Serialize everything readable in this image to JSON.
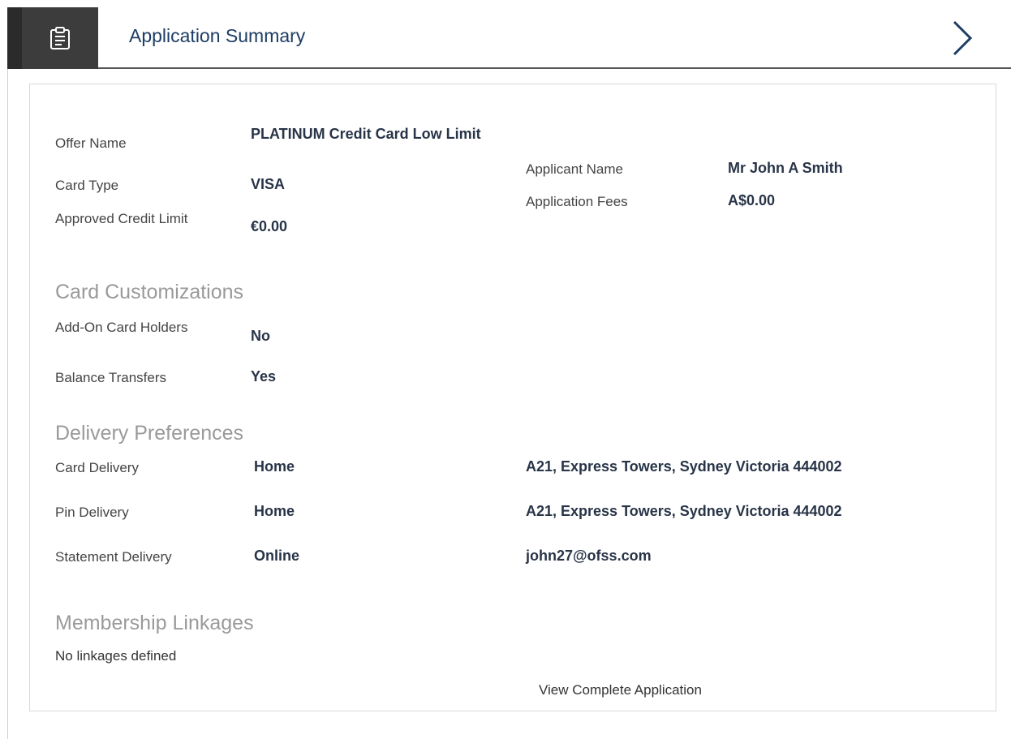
{
  "header": {
    "title": "Application Summary",
    "icon": "clipboard-icon",
    "next_icon": "chevron-right-icon"
  },
  "summary": {
    "offer_name_label": "Offer Name",
    "offer_name_value": "PLATINUM Credit Card Low Limit",
    "card_type_label": "Card Type",
    "card_type_value": "VISA",
    "credit_limit_label": "Approved Credit Limit",
    "credit_limit_value": "€0.00",
    "applicant_name_label": "Applicant Name",
    "applicant_name_value": "Mr John A Smith",
    "application_fees_label": "Application Fees",
    "application_fees_value": "A$0.00"
  },
  "customizations": {
    "heading": "Card Customizations",
    "addon_label": "Add-On Card Holders",
    "addon_value": "No",
    "balance_label": "Balance Transfers",
    "balance_value": "Yes"
  },
  "delivery": {
    "heading": "Delivery Preferences",
    "rows": [
      {
        "label": "Card Delivery",
        "mode": "Home",
        "address": "A21, Express Towers, Sydney Victoria 444002"
      },
      {
        "label": "Pin Delivery",
        "mode": "Home",
        "address": "A21, Express Towers, Sydney Victoria 444002"
      },
      {
        "label": "Statement Delivery",
        "mode": "Online",
        "address": "john27@ofss.com"
      }
    ]
  },
  "membership": {
    "heading": "Membership Linkages",
    "empty_text": "No linkages defined"
  },
  "actions": {
    "view_complete": "View Complete Application"
  }
}
